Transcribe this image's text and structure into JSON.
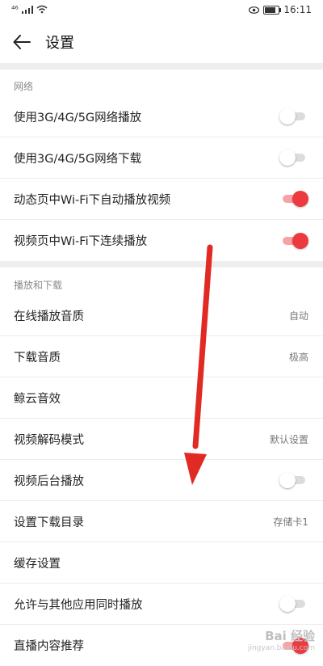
{
  "status": {
    "signal": "⁴⁶",
    "time": "16:11"
  },
  "header": {
    "title": "设置"
  },
  "sections": [
    {
      "title": "网络"
    },
    {
      "title": "播放和下载"
    }
  ],
  "network_rows": [
    {
      "label": "使用3G/4G/5G网络播放",
      "toggle": "off"
    },
    {
      "label": "使用3G/4G/5G网络下载",
      "toggle": "off"
    },
    {
      "label": "动态页中Wi-Fi下自动播放视频",
      "toggle": "on"
    },
    {
      "label": "视频页中Wi-Fi下连续播放",
      "toggle": "on"
    }
  ],
  "play_rows": [
    {
      "label": "在线播放音质",
      "value": "自动"
    },
    {
      "label": "下载音质",
      "value": "极高"
    },
    {
      "label": "鲸云音效",
      "value": ""
    },
    {
      "label": "视频解码模式",
      "value": "默认设置"
    },
    {
      "label": "视频后台播放",
      "toggle": "off"
    },
    {
      "label": "设置下载目录",
      "value": "存储卡1"
    },
    {
      "label": "缓存设置",
      "value": ""
    },
    {
      "label": "允许与其他应用同时播放",
      "toggle": "off"
    },
    {
      "label": "直播内容推荐",
      "toggle": "on"
    }
  ],
  "colors": {
    "accent": "#ec3a3f",
    "accent_track": "#f7a3a6",
    "section_band": "#eeeeee"
  },
  "watermark": {
    "brand": "Bai 经验",
    "url": "jingyan.baidu.com"
  }
}
